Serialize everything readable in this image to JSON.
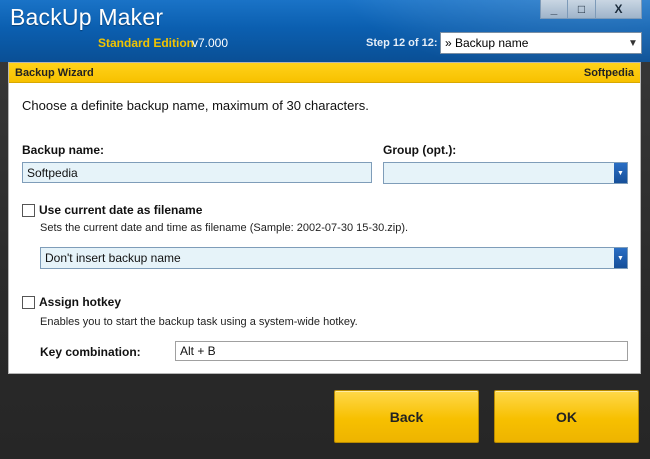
{
  "app": {
    "title": "BackUp Maker",
    "edition": "Standard Edition",
    "version": "v7.000",
    "window_buttons": {
      "minimize": "_",
      "maximize": "□",
      "close": "X"
    }
  },
  "step": {
    "label": "Step 12 of 12:",
    "selected": "» Backup name"
  },
  "panel": {
    "title": "Backup Wizard",
    "brand": "Softpedia",
    "instruction": "Choose a definite backup name, maximum of 30 characters.",
    "backup_name_label": "Backup name:",
    "backup_name_value": "Softpedia",
    "group_label": "Group (opt.):",
    "group_value": "",
    "use_date": {
      "label": "Use current date as filename",
      "checked": false,
      "description": "Sets the current date and time as filename (Sample: 2002-07-30 15-30.zip).",
      "option_selected": "Don't insert backup name"
    },
    "hotkey": {
      "label": "Assign hotkey",
      "checked": false,
      "description": "Enables you to start the backup task using a system-wide hotkey.",
      "key_label": "Key combination:",
      "key_value": "Alt + B"
    }
  },
  "buttons": {
    "back": "Back",
    "ok": "OK"
  },
  "colors": {
    "header_blue": "#0b5fb0",
    "accent_yellow": "#f7c100",
    "edition_yellow": "#f2c400",
    "input_bg": "#e6f3f9"
  }
}
